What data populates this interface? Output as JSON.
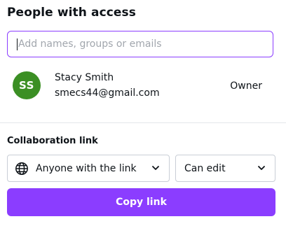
{
  "header": {
    "title": "People with access"
  },
  "search": {
    "placeholder": "Add names, groups or emails",
    "accent_color": "#8b3dff"
  },
  "people": [
    {
      "initials": "SS",
      "name": "Stacy Smith",
      "email": "smecs44@gmail.com",
      "role": "Owner",
      "avatar_color": "#3b8f24"
    }
  ],
  "collaboration": {
    "label": "Collaboration link",
    "access": {
      "value": "Anyone with the link",
      "icon": "globe-icon"
    },
    "permission": {
      "value": "Can edit"
    },
    "copy_label": "Copy link",
    "button_color": "#8b3dff"
  }
}
